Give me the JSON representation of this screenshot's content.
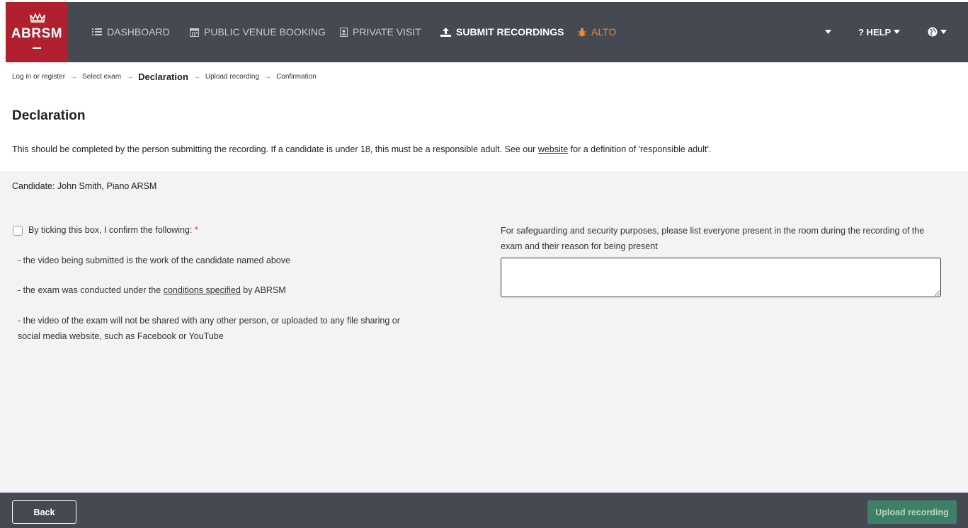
{
  "brand": {
    "logo_text": "ABRSM",
    "color": "#b1202e"
  },
  "nav": {
    "items": [
      {
        "label": "DASHBOARD",
        "icon": "list-icon"
      },
      {
        "label": "PUBLIC VENUE BOOKING",
        "icon": "calendar-icon"
      },
      {
        "label": "PRIVATE VISIT",
        "icon": "badge-icon"
      },
      {
        "label": "SUBMIT RECORDINGS",
        "icon": "upload-icon"
      },
      {
        "label": "ALTO",
        "icon": "bug-icon"
      }
    ],
    "help_label": "? HELP",
    "colors": {
      "bar": "#454a52",
      "alto": "#f08a3c"
    }
  },
  "breadcrumb": {
    "steps": [
      "Log in or register",
      "Select exam",
      "Declaration",
      "Upload recording",
      "Confirmation"
    ]
  },
  "page": {
    "title": "Declaration",
    "intro_before": "This should be completed by the person submitting the recording. If a candidate is under 18, this must be a responsible adult. See our ",
    "intro_link": "website",
    "intro_after": " for a definition of 'responsible adult'."
  },
  "form": {
    "candidate": "Candidate: John Smith, Piano ARSM",
    "confirm_label": "By ticking this box, I confirm the following: ",
    "required_mark": "*",
    "bullet1": "- the video being submitted is the work of the candidate named above",
    "bullet2_before": "- the exam was conducted under the ",
    "bullet2_link": "conditions specified",
    "bullet2_after": " by ABRSM",
    "bullet3_line1": "- the video of the exam will not be shared with any other person, or uploaded to any file sharing or",
    "bullet3_line2": "social media website, such as Facebook or YouTube",
    "safeguarding_label": "For safeguarding and security purposes, please list everyone present in the room during the recording of the exam and their reason for being present",
    "safeguarding_value": ""
  },
  "footer": {
    "back_label": "Back",
    "upload_label": "Upload recording",
    "upload_color": "#3f7f68"
  }
}
